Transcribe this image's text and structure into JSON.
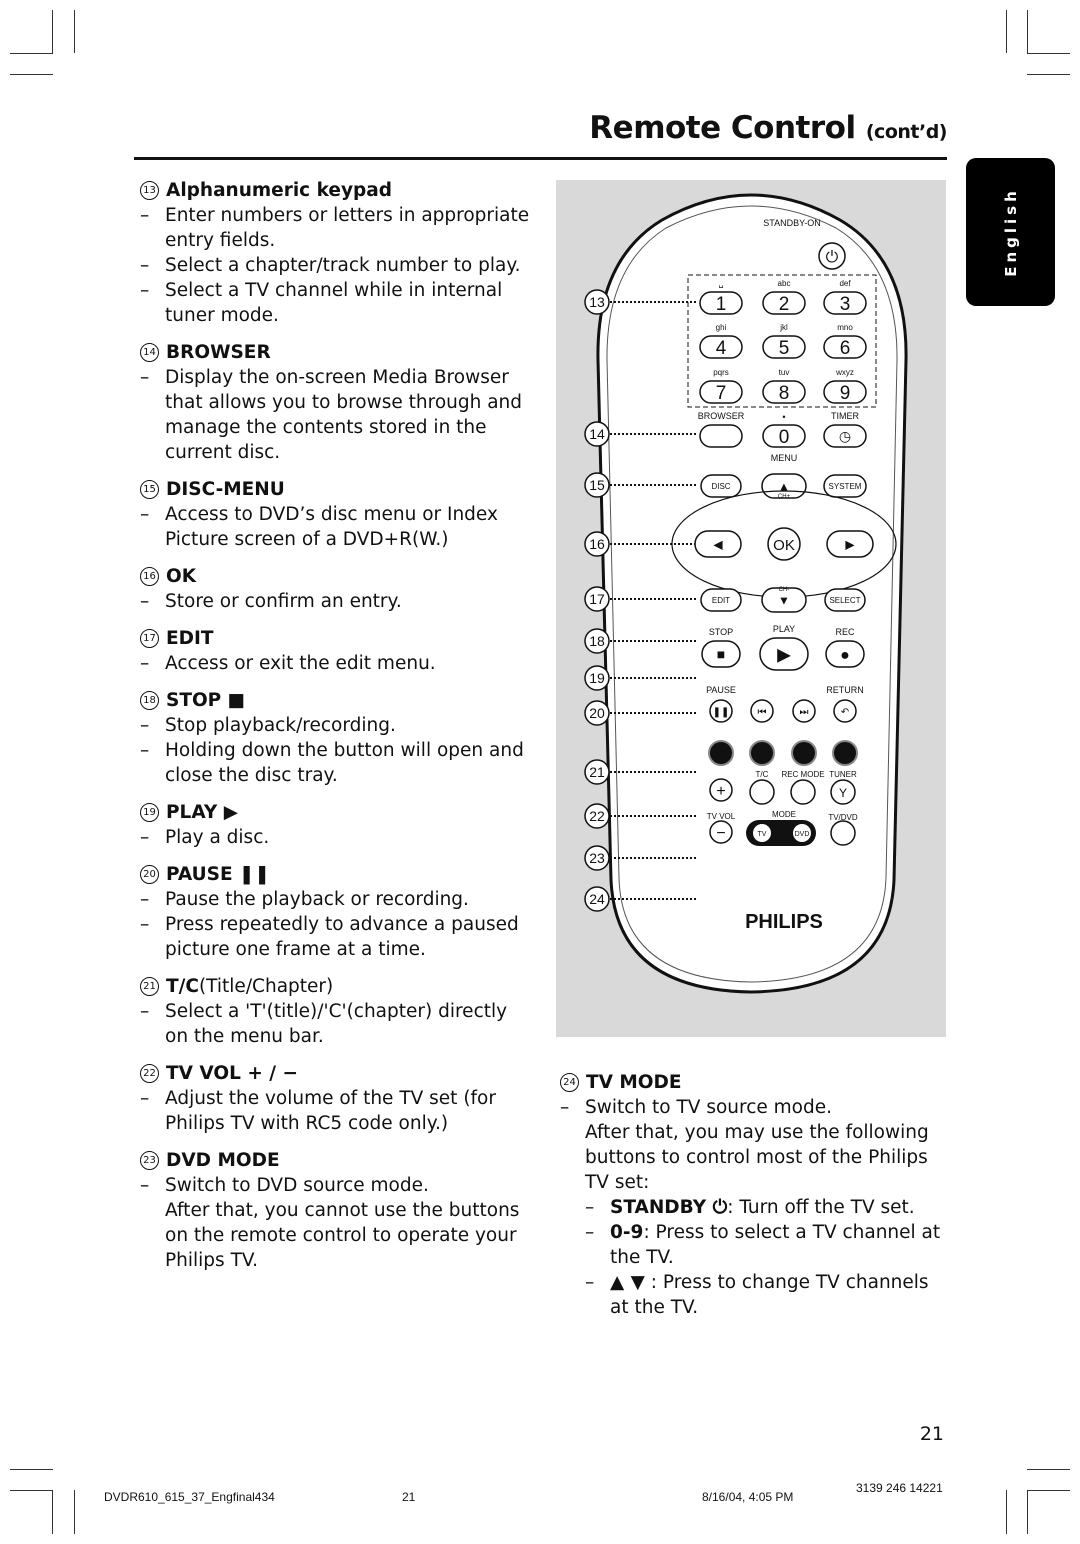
{
  "header": {
    "title": "Remote Control",
    "title_suffix": "(cont’d)"
  },
  "language_tab": "English",
  "left_sections": [
    {
      "num": "13",
      "title": "Alphanumeric keypad",
      "bullets": [
        "Enter numbers or letters in appropriate entry fields.",
        "Select a chapter/track number to play.",
        "Select a TV channel while in internal tuner mode."
      ]
    },
    {
      "num": "14",
      "title": "BROWSER",
      "bullets": [
        "Display the on-screen Media Browser that allows you to browse through and manage the contents stored in the current disc."
      ]
    },
    {
      "num": "15",
      "title": "DISC-MENU",
      "bullets": [
        "Access to DVD’s disc menu or Index Picture screen of a DVD+R(W.)"
      ]
    },
    {
      "num": "16",
      "title": "OK",
      "bullets": [
        "Store or confirm an entry."
      ]
    },
    {
      "num": "17",
      "title": "EDIT",
      "bullets": [
        "Access or exit the edit menu."
      ]
    },
    {
      "num": "18",
      "title": "STOP ■",
      "bullets": [
        "Stop playback/recording.",
        "Holding down the button will open and close the disc tray."
      ]
    },
    {
      "num": "19",
      "title": "PLAY ▶",
      "bullets": [
        "Play a disc."
      ]
    },
    {
      "num": "20",
      "title": "PAUSE ❚❚",
      "bullets": [
        "Pause the playback or recording.",
        "Press repeatedly to advance a paused picture one frame at a time."
      ]
    },
    {
      "num": "21",
      "title": "T/C",
      "title_extra": " (Title/Chapter)",
      "bullets": [
        "Select a 'T'(title)/'C'(chapter) directly on the menu bar."
      ]
    },
    {
      "num": "22",
      "title": "TV VOL + / −",
      "bullets": [
        "Adjust the volume of the TV set (for Philips TV with RC5 code only.)"
      ]
    },
    {
      "num": "23",
      "title": "DVD MODE",
      "bullets": [
        "Switch to DVD source mode."
      ],
      "cont": "After that, you cannot use the buttons on the remote control to operate your Philips TV."
    }
  ],
  "right_section": {
    "num": "24",
    "title": "TV MODE",
    "bullet": "Switch to TV source mode.",
    "cont": "After that, you may use the following buttons to control most of the Philips TV set:",
    "sub": [
      {
        "bold": "STANDBY ⏻",
        "text": ": Turn off the TV set."
      },
      {
        "bold": "0-9",
        "text": ": Press to select a TV channel at the TV."
      },
      {
        "bold": "▲ ▼",
        "text": " : Press to change TV channels at the TV."
      }
    ]
  },
  "remote": {
    "callouts": [
      "13",
      "14",
      "15",
      "16",
      "17",
      "18",
      "19",
      "20",
      "21",
      "22",
      "23",
      "24"
    ],
    "standby_label": "STANDBY-ON",
    "keys": [
      {
        "label": "1",
        "sub": "␣"
      },
      {
        "label": "2",
        "sub": "abc"
      },
      {
        "label": "3",
        "sub": "def"
      },
      {
        "label": "4",
        "sub": "ghi"
      },
      {
        "label": "5",
        "sub": "jkl"
      },
      {
        "label": "6",
        "sub": "mno"
      },
      {
        "label": "7",
        "sub": "pqrs"
      },
      {
        "label": "8",
        "sub": "tuv"
      },
      {
        "label": "9",
        "sub": "wxyz"
      }
    ],
    "browser": "BROWSER",
    "zero": "0",
    "dot": "•",
    "timer": "TIMER",
    "menu": "MENU",
    "disc": "DISC",
    "ch_plus": "CH+",
    "system": "SYSTEM",
    "ok": "OK",
    "edit": "EDIT",
    "ch_minus": "CH-",
    "select": "SELECT",
    "stop": "STOP",
    "play": "PLAY",
    "rec": "REC",
    "pause": "PAUSE",
    "return": "RETURN",
    "tc": "T/C",
    "rec_mode": "REC MODE",
    "tuner": "TUNER",
    "tv_vol": "TV VOL",
    "mode": "MODE",
    "tv": "TV",
    "dvd": "DVD",
    "tv_dvd": "TV/DVD",
    "brand": "PHILIPS"
  },
  "footer": {
    "page_number": "21",
    "file": "DVDR610_615_37_Engfinal434",
    "file_page": "21",
    "datetime": "8/16/04, 4:05 PM",
    "code": "3139 246 14221"
  }
}
